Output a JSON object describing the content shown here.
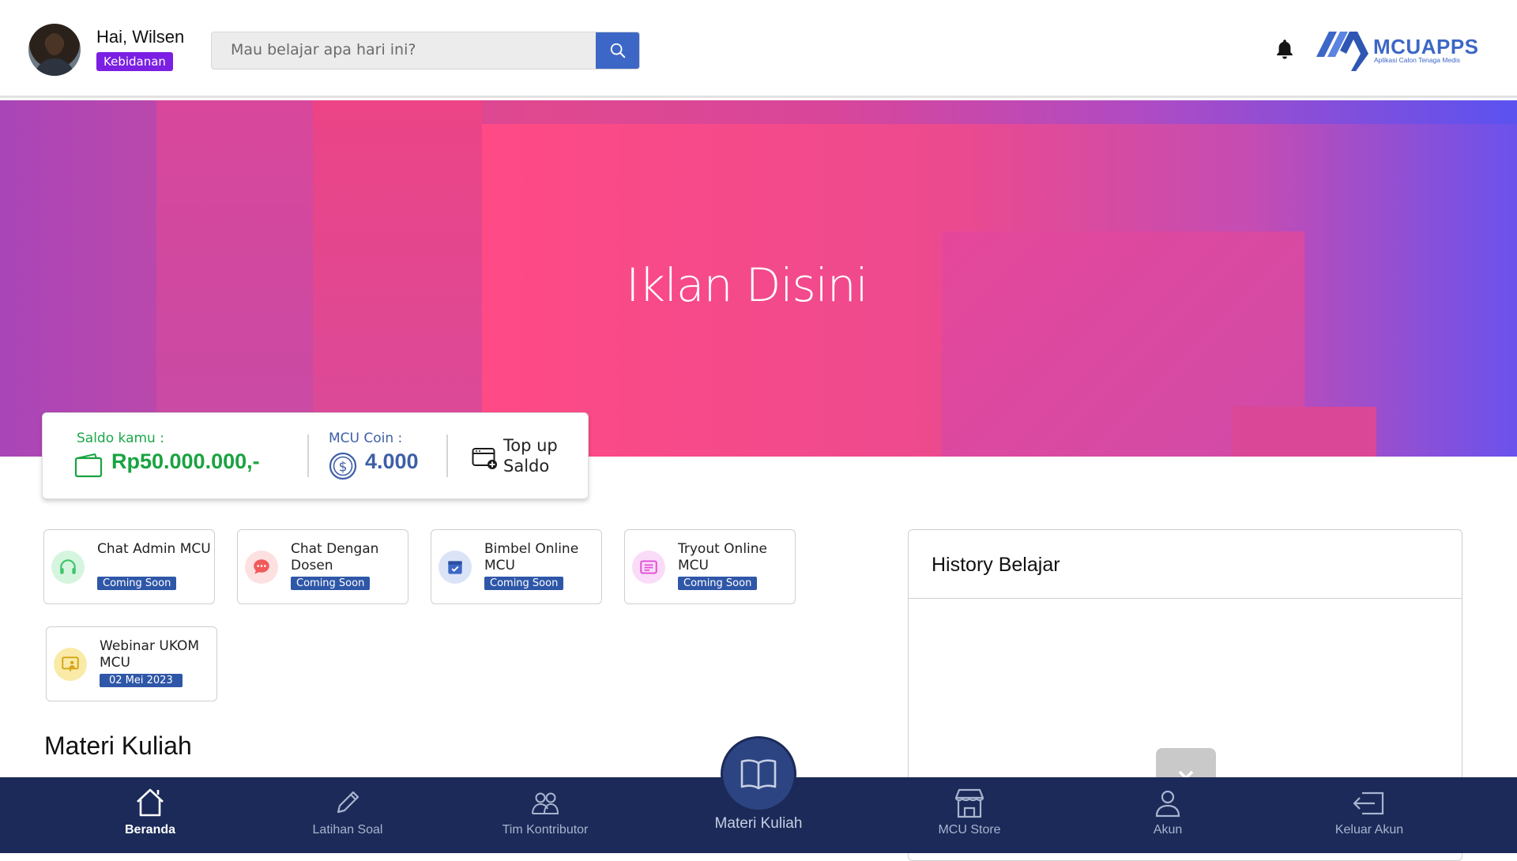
{
  "header": {
    "greeting": "Hai, Wilsen",
    "role": "Kebidanan",
    "search_placeholder": "Mau belajar apa hari ini?",
    "search_value": "",
    "logo_brand": "MCUAPPS",
    "logo_tagline": "Aplikasi Calon Tenaga Medis"
  },
  "banner": {
    "title": "Iklan Disini"
  },
  "balance": {
    "saldo_label": "Saldo kamu :",
    "saldo_value": "Rp50.000.000,-",
    "coin_label": "MCU Coin :",
    "coin_value": "4.000",
    "topup_label": "Top up Saldo"
  },
  "features": [
    {
      "title": "Chat Admin MCU",
      "badge": "Coming Soon",
      "icon": "headset-icon",
      "color": "#3cc46a"
    },
    {
      "title": "Chat Dengan Dosen",
      "badge": "Coming Soon",
      "icon": "chat-bubble-icon",
      "color": "#f05a5a"
    },
    {
      "title": "Bimbel Online MCU",
      "badge": "Coming Soon",
      "icon": "calendar-check-icon",
      "color": "#3d67c6"
    },
    {
      "title": "Tryout Online MCU",
      "badge": "Coming Soon",
      "icon": "list-doc-icon",
      "color": "#e14fd8"
    },
    {
      "title": "Webinar UKOM MCU",
      "badge": "02 Mei 2023",
      "icon": "presentation-icon",
      "color": "#e0b21a"
    }
  ],
  "sections": {
    "materi_title": "Materi Kuliah",
    "history_title": "History Belajar"
  },
  "nav": {
    "items": [
      {
        "label": "Beranda",
        "icon": "home-icon"
      },
      {
        "label": "Latihan Soal",
        "icon": "pencil-icon"
      },
      {
        "label": "Tim Kontributor",
        "icon": "team-icon"
      },
      {
        "label": "Materi Kuliah",
        "icon": "book-icon"
      },
      {
        "label": "MCU Store",
        "icon": "store-icon"
      },
      {
        "label": "Akun",
        "icon": "user-icon"
      },
      {
        "label": "Keluar Akun",
        "icon": "logout-icon"
      }
    ]
  },
  "colors": {
    "accent": "#3d67c6",
    "role_badge": "#7a1fe3",
    "saldo_green": "#19a340",
    "nav_bg": "#1b2a58"
  }
}
